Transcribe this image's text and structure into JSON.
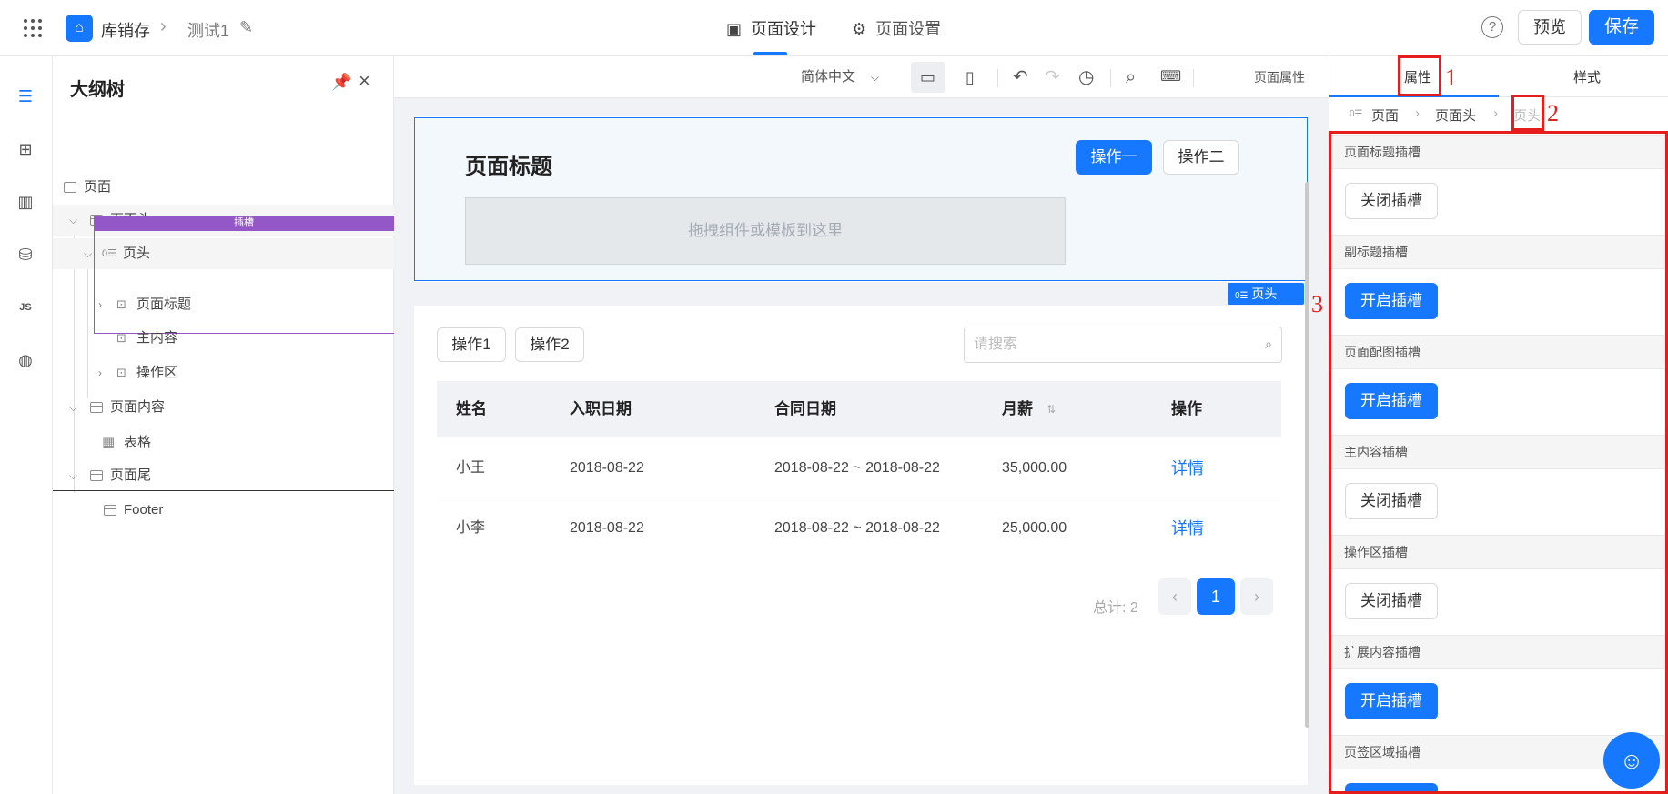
{
  "topbar": {
    "app_name": "库销存",
    "breadcrumb_sep": "›",
    "page_name": "测试1",
    "tab_design": "页面设计",
    "tab_settings": "页面设置",
    "help": "?",
    "preview": "预览",
    "save": "保存",
    "accent": "#1677ff"
  },
  "rail": {
    "icons": [
      "outline-icon",
      "components-icon",
      "layout-icon",
      "datasource-icon",
      "js-icon",
      "globe-icon"
    ],
    "js_label": "JS"
  },
  "outline": {
    "title": "大纲树",
    "slot_label": "插槽",
    "nodes": [
      {
        "label": "页面"
      },
      {
        "label": "页面头"
      },
      {
        "label": "页头"
      },
      {
        "label": "页面标题"
      },
      {
        "label": "主内容"
      },
      {
        "label": "操作区"
      },
      {
        "label": "页面内容"
      },
      {
        "label": "表格"
      },
      {
        "label": "页面尾"
      },
      {
        "label": "Footer"
      }
    ]
  },
  "toolbar": {
    "language": "简体中文",
    "page_props": "页面属性"
  },
  "canvas": {
    "page_title": "页面标题",
    "action1": "操作一",
    "action2": "操作二",
    "drop_hint": "拖拽组件或模板到这里",
    "selection_tag": "页头",
    "buttons": [
      "操作1",
      "操作2"
    ],
    "search_placeholder": "请搜索",
    "table": {
      "headers": [
        "姓名",
        "入职日期",
        "合同日期",
        "月薪",
        "操作"
      ],
      "rows": [
        [
          "小王",
          "2018-08-22",
          "2018-08-22 ~ 2018-08-22",
          "35,000.00",
          "详情"
        ],
        [
          "小李",
          "2018-08-22",
          "2018-08-22 ~ 2018-08-22",
          "25,000.00",
          "详情"
        ]
      ]
    },
    "total": "总计: 2",
    "current_page": "1"
  },
  "props": {
    "tab_attrs": "属性",
    "tab_style": "样式",
    "crumbs": [
      "页面",
      "页面头",
      "页头"
    ],
    "slots": [
      {
        "title": "页面标题插槽",
        "button": "关闭插槽",
        "state": "off"
      },
      {
        "title": "副标题插槽",
        "button": "开启插槽",
        "state": "on"
      },
      {
        "title": "页面配图插槽",
        "button": "开启插槽",
        "state": "on"
      },
      {
        "title": "主内容插槽",
        "button": "关闭插槽",
        "state": "off"
      },
      {
        "title": "操作区插槽",
        "button": "关闭插槽",
        "state": "off"
      },
      {
        "title": "扩展内容插槽",
        "button": "开启插槽",
        "state": "on"
      },
      {
        "title": "页签区域插槽",
        "button": "",
        "state": "on"
      }
    ]
  },
  "annotations": {
    "n1": "1",
    "n2": "2",
    "n3": "3",
    "color": "#e51d1d"
  }
}
